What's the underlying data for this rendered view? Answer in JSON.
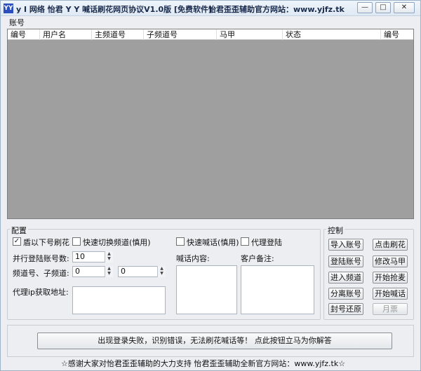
{
  "window": {
    "icon_text": "YY",
    "title": "y I 网络 怡君 Y Y 喊话刷花网页协议V1.0版 [免费软件]",
    "site": "怡君歪歪辅助官方网站：www.yjfz.tk",
    "minimize": "—",
    "restore": "□",
    "close": "✕"
  },
  "accounts": {
    "group_label": "账号",
    "columns": [
      "编号",
      "用户名",
      "主频道号",
      "子频道号",
      "马甲",
      "状态",
      "编号"
    ]
  },
  "config": {
    "group_label": "配置",
    "brush_checkbox": {
      "label": "盾以下号刷花",
      "checked": true
    },
    "switch_checkbox": {
      "label": "快速切换频道(慎用)",
      "checked": false
    },
    "shout_checkbox": {
      "label": "快速喊话(慎用)",
      "checked": false
    },
    "proxy_checkbox": {
      "label": "代理登陆",
      "checked": false
    },
    "parallel_label": "并行登陆账号数:",
    "parallel_value": "10",
    "channel_label": "频道号、子频道:",
    "channel_main": "0",
    "channel_sub": "0",
    "proxy_addr_label": "代理ip获取地址:",
    "shout_content_label": "喊话内容:",
    "note_label": "客户备注:"
  },
  "control": {
    "group_label": "控制",
    "buttons": [
      "导入账号",
      "点击刷花",
      "登陆账号",
      "修改马甲",
      "进入频道",
      "开始抢麦",
      "分离账号",
      "开始喊话",
      "封号还原",
      "月票"
    ]
  },
  "status": {
    "message": "出现登录失败，识别错误，无法刷花喊话等！  点此按钮立马为你解答"
  },
  "footer": {
    "text": "☆感谢大家对怡君歪歪辅助的大力支持 怡君歪歪辅助全新官方网站：www.yjfz.tk☆"
  }
}
